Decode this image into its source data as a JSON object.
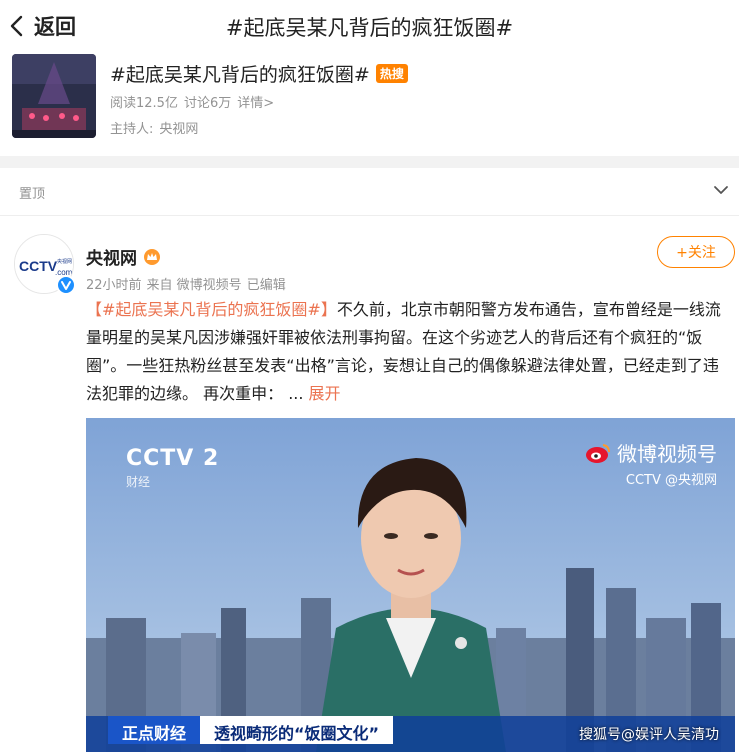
{
  "header": {
    "back_label": "返回",
    "title": "#起底吴某凡背后的疯狂饭圈#"
  },
  "topic": {
    "name": "#起底吴某凡背后的疯狂饭圈#",
    "badge": "热搜",
    "reads": "阅读12.5亿",
    "discussions": "讨论6万",
    "detail_link": "详情>",
    "host_label": "主持人:",
    "host_name": "央视网"
  },
  "pinned": {
    "label": "置顶"
  },
  "post": {
    "author": "央视网",
    "time": "22小时前",
    "source": "来自 微博视频号",
    "edited": "已编辑",
    "follow_label": "+关注",
    "hashtag": "【#起底吴某凡背后的疯狂饭圈#】",
    "text": "不久前，北京市朝阳警方发布通告，宣布曾经是一线流量明星的吴某凡因涉嫌强奸罪被依法刑事拘留。在这个劣迹艺人的背后还有个疯狂的“饭圈”。一些狂热粉丝甚至发表“出格”言论，妄想让自己的偶像躲避法律处置，已经走到了违法犯罪的边缘。 再次重申：",
    "ellipsis": "...",
    "expand": "展开"
  },
  "video": {
    "channel_name": "CCTV 2",
    "channel_sub": "财经",
    "brand": "微博视频号",
    "brand_sub": "CCTV @央视网",
    "ticker_a": "正点财经",
    "ticker_b": "透视畸形的“饭圈文化”",
    "watermark": "搜狐号@娱评人吴清功"
  },
  "colors": {
    "accent": "#ff8200",
    "link": "#eb7350",
    "meta": "#939393"
  }
}
